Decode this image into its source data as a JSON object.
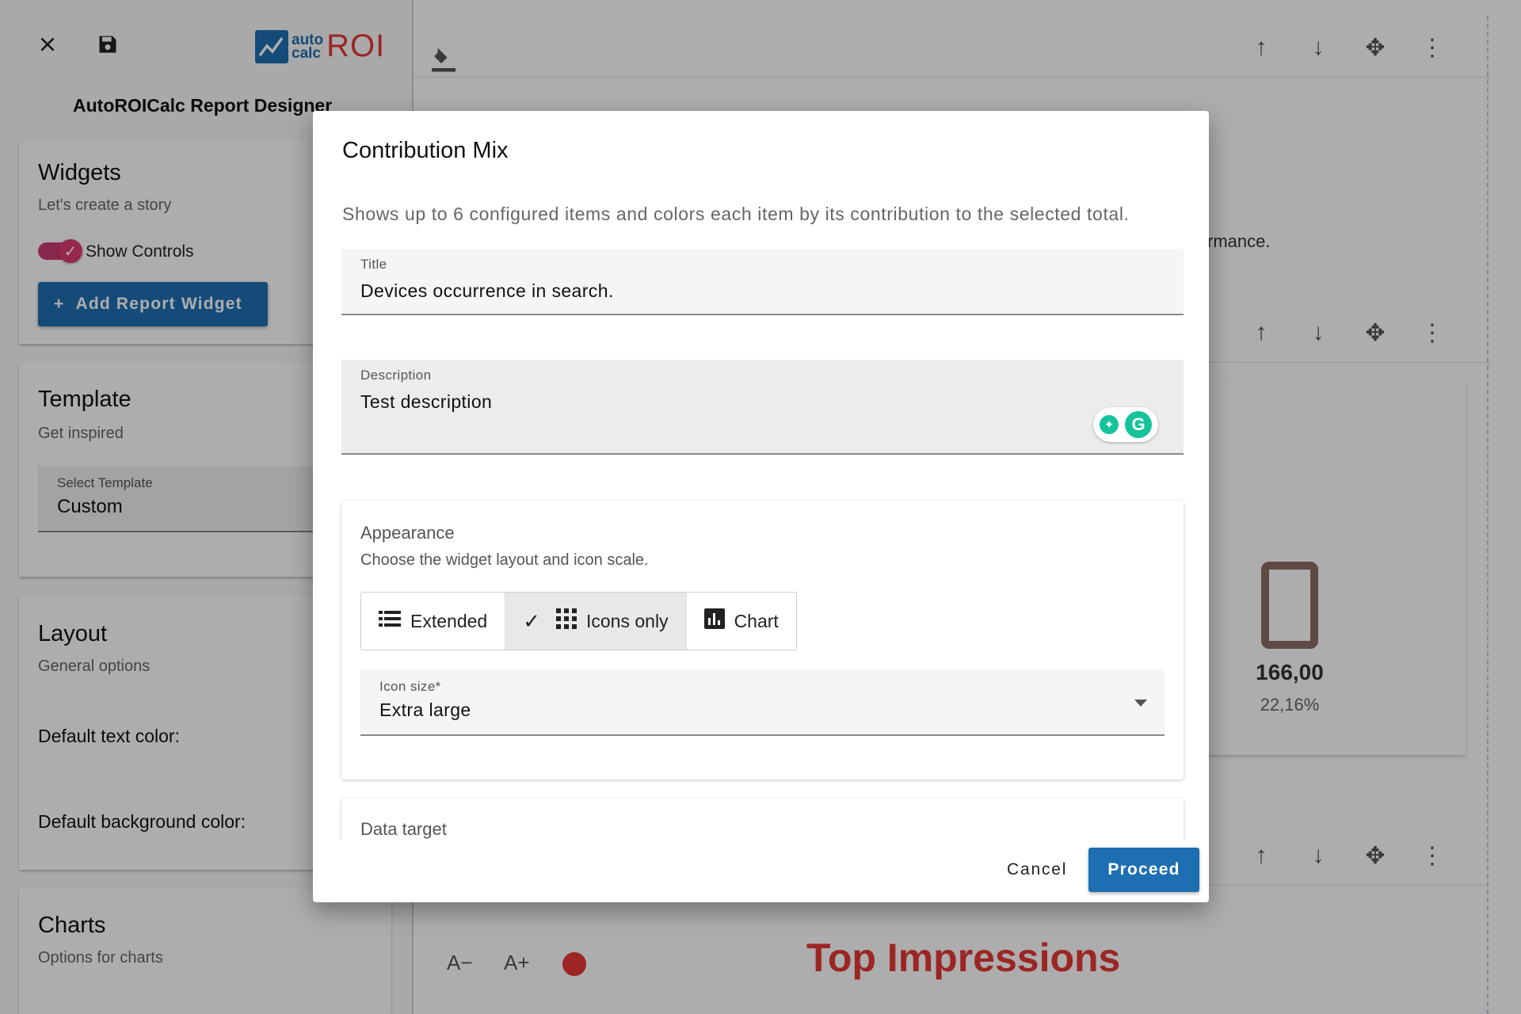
{
  "app": {
    "logo_small_top": "auto",
    "logo_small_bottom": "calc",
    "logo_big": "ROI",
    "designer_title": "AutoROICalc Report Designer"
  },
  "widgets": {
    "title": "Widgets",
    "subtitle": "Let's create a story",
    "toggle_label": "Show Controls",
    "toggle_on": true,
    "add_button": "Add Report Widget"
  },
  "template": {
    "title": "Template",
    "subtitle": "Get inspired",
    "select_label": "Select Template",
    "select_value": "Custom"
  },
  "layout": {
    "title": "Layout",
    "subtitle": "General options",
    "text_color_label": "Default text color:",
    "bg_color_label": "Default background color:"
  },
  "charts": {
    "title": "Charts",
    "subtitle": "Options for charts"
  },
  "canvas": {
    "partial_text": "rmance.",
    "device_value": "166,00",
    "device_pct": "22,16%",
    "font_decrease": "A−",
    "font_increase": "A+",
    "heading": "Top Impressions",
    "heading_color": "#e53935"
  },
  "dialog": {
    "title": "Contribution Mix",
    "description": "Shows up to 6 configured items and colors each item by its contribution to the selected total.",
    "title_field": {
      "label": "Title",
      "value": "Devices occurrence in search."
    },
    "description_field": {
      "label": "Description",
      "value": "Test description"
    },
    "appearance": {
      "title": "Appearance",
      "subtitle": "Choose the widget layout and icon scale.",
      "options": [
        "Extended",
        "Icons only",
        "Chart"
      ],
      "selected": "Icons only",
      "icon_size_label": "Icon size*",
      "icon_size_value": "Extra large"
    },
    "data_target": {
      "title": "Data target"
    },
    "cancel": "Cancel",
    "proceed": "Proceed"
  },
  "colors": {
    "primary": "#1e6fb2",
    "accent": "#d81b60",
    "brand_red": "#e53935"
  }
}
